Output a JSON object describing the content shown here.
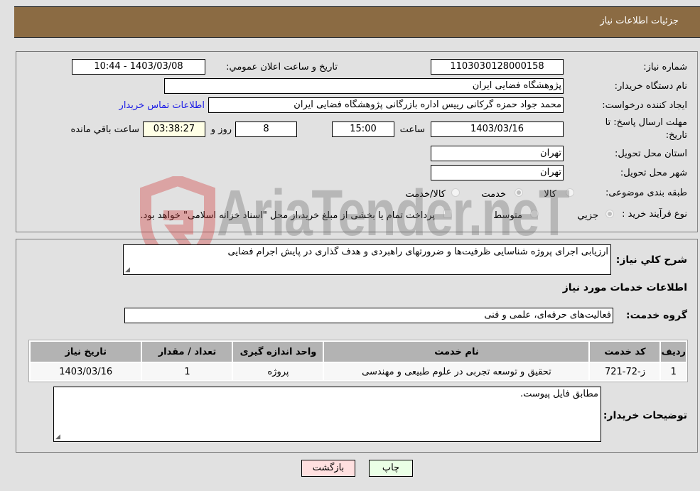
{
  "header": {
    "title": "جزئیات اطلاعات نیاز"
  },
  "details": {
    "need_number_label": "شماره نیاز:",
    "need_number": "1103030128000158",
    "announce_label": "تاریخ و ساعت اعلان عمومي:",
    "announce_value": "1403/03/08 - 10:44",
    "buyer_org_label": "نام دستگاه خریدار:",
    "buyer_org": "پژوهشگاه فضایی ایران",
    "creator_label": "ایجاد کننده درخواست:",
    "creator": "محمد جواد حمزه گرکانی رییس اداره بازرگانی پژوهشگاه فضایی ایران",
    "contact_link": "اطلاعات تماس خریدار",
    "deadline_label_line1": "مهلت ارسال پاسخ: تا",
    "deadline_label_line2": "تاریخ:",
    "deadline_date": "1403/03/16",
    "time_label": "ساعت",
    "deadline_time": "15:00",
    "days_value": "8",
    "days_label": "روز و",
    "remaining_time": "03:38:27",
    "remaining_label": "ساعت باقي مانده",
    "province_label": "استان محل تحویل:",
    "province": "تهران",
    "city_label": "شهر محل تحویل:",
    "city": "تهران",
    "category_label": "طبقه بندی موضوعی:",
    "category_options": [
      {
        "label": "کالا",
        "checked": false
      },
      {
        "label": "خدمت",
        "checked": true
      },
      {
        "label": "کالا/خدمت",
        "checked": false
      }
    ],
    "process_label": "نوع فرآیند خرید :",
    "process_options": [
      {
        "label": "جزيي",
        "checked": true
      },
      {
        "label": "متوسط",
        "checked": false
      }
    ],
    "treasury_text": "پرداخت تمام یا بخشی از مبلغ خرید،از محل \"اسناد خزانه اسلامی\" خواهد بود."
  },
  "description": {
    "label": "شرح کلي نياز:",
    "value": "ارزیابی اجرای پروژه شناسایی ظرفیت‌ها و ضرورتهای راهبردی و هدف گذاری در پایش اجرام فضایی"
  },
  "services": {
    "section_title": "اطلاعات خدمات مورد نياز",
    "group_label": "گروه خدمت:",
    "group_value": "فعالیت‌های حرفه‌ای، علمی و فنی",
    "columns": [
      "ردیف",
      "کد خدمت",
      "نام خدمت",
      "واحد اندازه گیری",
      "تعداد / مقدار",
      "تاریخ نیاز"
    ],
    "rows": [
      [
        "1",
        "ز-72-721",
        "تحقیق و توسعه تجربی در علوم طبیعی و مهندسی",
        "پروژه",
        "1",
        "1403/03/16"
      ]
    ]
  },
  "buyer_notes": {
    "label": "توضیحات خریدار:",
    "value": "مطابق فایل پیوست."
  },
  "buttons": {
    "print": "چاپ",
    "back": "بازگشت"
  },
  "watermark": {
    "text": "AriaTender.neT"
  }
}
